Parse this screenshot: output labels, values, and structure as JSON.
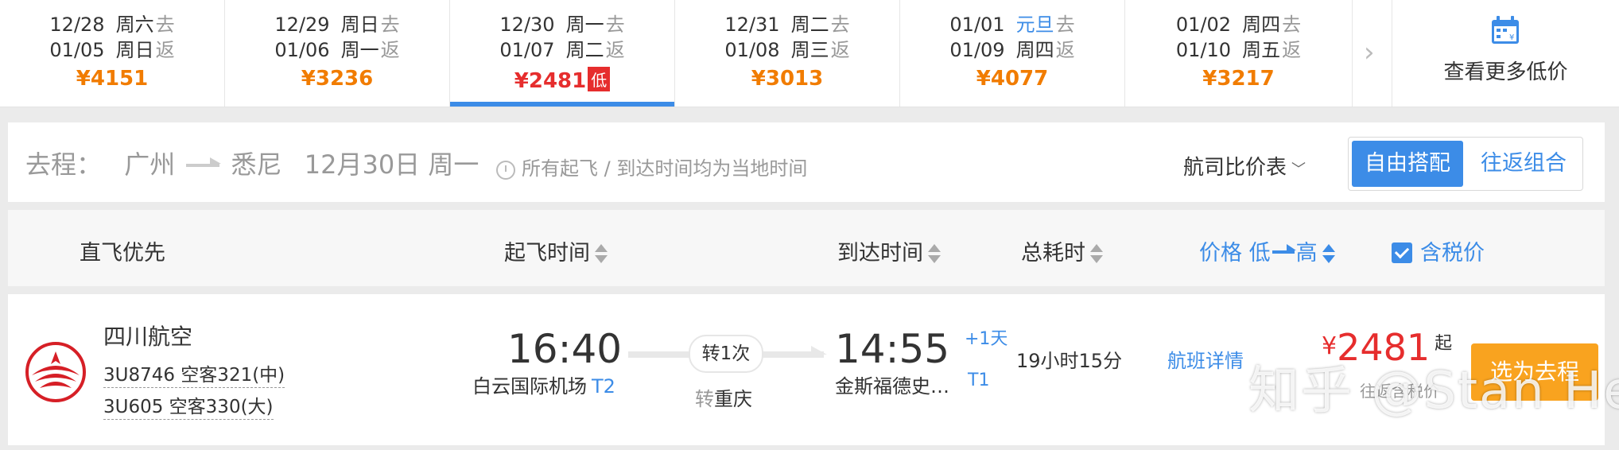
{
  "date_bar": {
    "cells": [
      {
        "depart_date": "12/28",
        "depart_day": "周六",
        "depart_tag": "去",
        "return_date": "01/05",
        "return_day": "周日",
        "return_tag": "返",
        "price": "¥4151"
      },
      {
        "depart_date": "12/29",
        "depart_day": "周日",
        "depart_tag": "去",
        "return_date": "01/06",
        "return_day": "周一",
        "return_tag": "返",
        "price": "¥3236"
      },
      {
        "depart_date": "12/30",
        "depart_day": "周一",
        "depart_tag": "去",
        "return_date": "01/07",
        "return_day": "周二",
        "return_tag": "返",
        "price": "¥2481",
        "badge": "低"
      },
      {
        "depart_date": "12/31",
        "depart_day": "周二",
        "depart_tag": "去",
        "return_date": "01/08",
        "return_day": "周三",
        "return_tag": "返",
        "price": "¥3013"
      },
      {
        "depart_date": "01/01",
        "depart_day": "元旦",
        "depart_tag": "去",
        "return_date": "01/09",
        "return_day": "周四",
        "return_tag": "返",
        "price": "¥4077"
      },
      {
        "depart_date": "01/02",
        "depart_day": "周四",
        "depart_tag": "去",
        "return_date": "01/10",
        "return_day": "周五",
        "return_tag": "返",
        "price": "¥3217"
      }
    ],
    "next_arrow": "›",
    "more_label": "查看更多低价",
    "more_icon": "calendar-icon"
  },
  "route_bar": {
    "prefix": "去程：",
    "from": "广州",
    "to": "悉尼",
    "date": "12月30日 周一",
    "note": "所有起飞 / 到达时间均为当地时间",
    "compare_label": "航司比价表",
    "toggle_active": "自由搭配",
    "toggle_inactive": "往返组合"
  },
  "sort_bar": {
    "direct_first": "直飞优先",
    "depart_time": "起飞时间",
    "arrive_time": "到达时间",
    "duration": "总耗时",
    "price_prefix": "价格 低",
    "price_suffix": "高",
    "tax_included": "含税价"
  },
  "flight": {
    "airline": "四川航空",
    "flight1": "3U8746 空客321(中)",
    "flight2": "3U605 空客330(大)",
    "depart_time": "16:40",
    "depart_airport": "白云国际机场",
    "depart_terminal": "T2",
    "stops": "转1次",
    "via_prefix": "转",
    "via_city": "重庆",
    "arrive_time": "14:55",
    "plus_day": "+1天",
    "arrive_airport": "金斯福德史…",
    "arrive_terminal": "T1",
    "duration": "19小时15分",
    "detail_link": "航班详情",
    "currency": "¥",
    "price": "2481",
    "price_suffix": "起",
    "tax_note": "往返含税价",
    "select_button": "选为去程"
  },
  "watermark": "知乎 @Stan He",
  "colors": {
    "accent": "#3c8ce7",
    "price_orange": "#f17c00",
    "price_red": "#e62d2d",
    "select_button": "#f9a31f"
  }
}
